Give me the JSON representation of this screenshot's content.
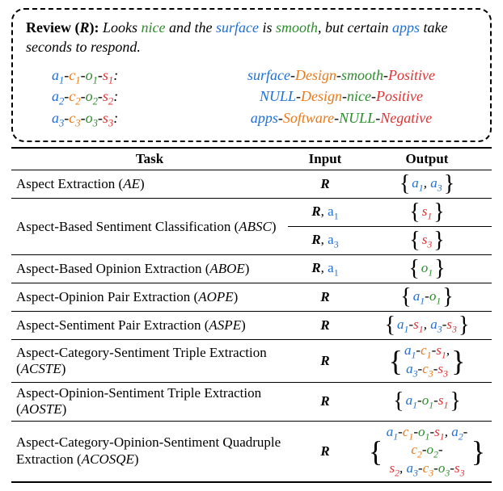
{
  "review": {
    "label": "Review (",
    "symbol": "R",
    "close": "): ",
    "text_parts": [
      {
        "t": "Looks ",
        "cls": ""
      },
      {
        "t": "nice",
        "cls": "o"
      },
      {
        "t": " and the ",
        "cls": ""
      },
      {
        "t": "surface",
        "cls": "a"
      },
      {
        "t": " is ",
        "cls": ""
      },
      {
        "t": "smooth",
        "cls": "o"
      },
      {
        "t": ", but certain ",
        "cls": ""
      },
      {
        "t": "apps",
        "cls": "a"
      },
      {
        "t": " take seconds to respond.",
        "cls": ""
      }
    ]
  },
  "triples": [
    {
      "lhs": [
        {
          "t": "a",
          "sub": "1",
          "cls": "a"
        },
        {
          "t": "-",
          "cls": "dash"
        },
        {
          "t": "c",
          "sub": "1",
          "cls": "c"
        },
        {
          "t": "-",
          "cls": "dash"
        },
        {
          "t": "o",
          "sub": "1",
          "cls": "o"
        },
        {
          "t": "-",
          "cls": "dash"
        },
        {
          "t": "s",
          "sub": "1",
          "cls": "s"
        },
        {
          "t": ":",
          "cls": "dash"
        }
      ],
      "rhs": [
        {
          "t": "surface",
          "cls": "a"
        },
        {
          "t": "-",
          "cls": "dash"
        },
        {
          "t": "Design",
          "cls": "c"
        },
        {
          "t": "-",
          "cls": "dash"
        },
        {
          "t": "smooth",
          "cls": "o"
        },
        {
          "t": "-",
          "cls": "dash"
        },
        {
          "t": "Positive",
          "cls": "s"
        }
      ]
    },
    {
      "lhs": [
        {
          "t": "a",
          "sub": "2",
          "cls": "a"
        },
        {
          "t": "-",
          "cls": "dash"
        },
        {
          "t": "c",
          "sub": "2",
          "cls": "c"
        },
        {
          "t": "-",
          "cls": "dash"
        },
        {
          "t": "o",
          "sub": "2",
          "cls": "o"
        },
        {
          "t": "-",
          "cls": "dash"
        },
        {
          "t": "s",
          "sub": "2",
          "cls": "s"
        },
        {
          "t": ":",
          "cls": "dash"
        }
      ],
      "rhs": [
        {
          "t": "NULL",
          "cls": "a"
        },
        {
          "t": "-",
          "cls": "dash"
        },
        {
          "t": "Design",
          "cls": "c"
        },
        {
          "t": "-",
          "cls": "dash"
        },
        {
          "t": "nice",
          "cls": "o"
        },
        {
          "t": "-",
          "cls": "dash"
        },
        {
          "t": "Positive",
          "cls": "s"
        }
      ]
    },
    {
      "lhs": [
        {
          "t": "a",
          "sub": "3",
          "cls": "a"
        },
        {
          "t": "-",
          "cls": "dash"
        },
        {
          "t": "c",
          "sub": "3",
          "cls": "c"
        },
        {
          "t": "-",
          "cls": "dash"
        },
        {
          "t": "o",
          "sub": "3",
          "cls": "o"
        },
        {
          "t": "-",
          "cls": "dash"
        },
        {
          "t": "s",
          "sub": "3",
          "cls": "s"
        },
        {
          "t": ":",
          "cls": "dash"
        }
      ],
      "rhs": [
        {
          "t": "apps",
          "cls": "a"
        },
        {
          "t": "-",
          "cls": "dash"
        },
        {
          "t": "Software",
          "cls": "c"
        },
        {
          "t": "-",
          "cls": "dash"
        },
        {
          "t": "NULL",
          "cls": "o"
        },
        {
          "t": "-",
          "cls": "dash"
        },
        {
          "t": "Negative",
          "cls": "s"
        }
      ]
    }
  ],
  "table": {
    "headers": {
      "task": "Task",
      "input": "Input",
      "output": "Output"
    },
    "rows": [
      {
        "name": "Aspect Extraction",
        "abbrev": "AE",
        "inputs": [
          [
            {
              "t": "R",
              "bold": true
            }
          ]
        ],
        "outputs": [
          [
            [
              {
                "t": "a",
                "sub": "1",
                "cls": "a"
              },
              {
                "t": ", ",
                "cls": "dash"
              },
              {
                "t": "a",
                "sub": "3",
                "cls": "a"
              }
            ]
          ]
        ]
      },
      {
        "name": "Aspect-Based Sentiment Classification",
        "abbrev": "ABSC",
        "multi": true,
        "inputs": [
          [
            {
              "t": "R",
              "bold": true
            },
            {
              "t": ", "
            },
            {
              "t": "a",
              "sub": "1",
              "cls": "a"
            }
          ],
          [
            {
              "t": "R",
              "bold": true
            },
            {
              "t": ", "
            },
            {
              "t": "a",
              "sub": "3",
              "cls": "a"
            }
          ]
        ],
        "outputs": [
          [
            [
              {
                "t": "s",
                "sub": "1",
                "cls": "s"
              }
            ]
          ],
          [
            [
              {
                "t": "s",
                "sub": "3",
                "cls": "s"
              }
            ]
          ]
        ]
      },
      {
        "name": "Aspect-Based Opinion Extraction",
        "abbrev": "ABOE",
        "inputs": [
          [
            {
              "t": "R",
              "bold": true
            },
            {
              "t": ", "
            },
            {
              "t": "a",
              "sub": "1",
              "cls": "a"
            }
          ]
        ],
        "outputs": [
          [
            [
              {
                "t": "o",
                "sub": "1",
                "cls": "o"
              }
            ]
          ]
        ]
      },
      {
        "name": "Aspect-Opinion Pair Extraction",
        "abbrev": "AOPE",
        "inputs": [
          [
            {
              "t": "R",
              "bold": true
            }
          ]
        ],
        "outputs": [
          [
            [
              {
                "t": "a",
                "sub": "1",
                "cls": "a"
              },
              {
                "t": "-",
                "cls": "dash"
              },
              {
                "t": "o",
                "sub": "1",
                "cls": "o"
              }
            ]
          ]
        ]
      },
      {
        "name": "Aspect-Sentiment Pair Extraction",
        "abbrev": "ASPE",
        "inputs": [
          [
            {
              "t": "R",
              "bold": true
            }
          ]
        ],
        "outputs": [
          [
            [
              {
                "t": "a",
                "sub": "1",
                "cls": "a"
              },
              {
                "t": "-",
                "cls": "dash"
              },
              {
                "t": "s",
                "sub": "1",
                "cls": "s"
              },
              {
                "t": ", ",
                "cls": "dash"
              },
              {
                "t": "a",
                "sub": "3",
                "cls": "a"
              },
              {
                "t": "-",
                "cls": "dash"
              },
              {
                "t": "s",
                "sub": "3",
                "cls": "s"
              }
            ]
          ]
        ]
      },
      {
        "name": "Aspect-Category-Sentiment Triple Extraction",
        "abbrev": "ACSTE",
        "multi": true,
        "inputs": [
          [
            {
              "t": "R",
              "bold": true
            }
          ]
        ],
        "outputs": [
          [
            [
              {
                "t": "a",
                "sub": "1",
                "cls": "a"
              },
              {
                "t": "-",
                "cls": "dash"
              },
              {
                "t": "c",
                "sub": "1",
                "cls": "c"
              },
              {
                "t": "-",
                "cls": "dash"
              },
              {
                "t": "s",
                "sub": "1",
                "cls": "s"
              },
              {
                "t": ",",
                "cls": "dash"
              }
            ],
            [
              {
                "t": "a",
                "sub": "3",
                "cls": "a"
              },
              {
                "t": "-",
                "cls": "dash"
              },
              {
                "t": "c",
                "sub": "3",
                "cls": "c"
              },
              {
                "t": "-",
                "cls": "dash"
              },
              {
                "t": "s",
                "sub": "3",
                "cls": "s"
              }
            ]
          ]
        ]
      },
      {
        "name": "Aspect-Opinion-Sentiment Triple Extraction",
        "abbrev": "AOSTE",
        "multi": true,
        "inputs": [
          [
            {
              "t": "R",
              "bold": true
            }
          ]
        ],
        "outputs": [
          [
            [
              {
                "t": "a",
                "sub": "1",
                "cls": "a"
              },
              {
                "t": "-",
                "cls": "dash"
              },
              {
                "t": "o",
                "sub": "1",
                "cls": "o"
              },
              {
                "t": "-",
                "cls": "dash"
              },
              {
                "t": "s",
                "sub": "1",
                "cls": "s"
              }
            ]
          ]
        ]
      },
      {
        "name": "Aspect-Category-Opinion-Sentiment Quadruple Extraction",
        "abbrev": "ACOSQE",
        "multi": true,
        "inputs": [
          [
            {
              "t": "R",
              "bold": true
            }
          ]
        ],
        "outputs": [
          [
            [
              {
                "t": "a",
                "sub": "1",
                "cls": "a"
              },
              {
                "t": "-",
                "cls": "dash"
              },
              {
                "t": "c",
                "sub": "1",
                "cls": "c"
              },
              {
                "t": "-",
                "cls": "dash"
              },
              {
                "t": "o",
                "sub": "1",
                "cls": "o"
              },
              {
                "t": "-",
                "cls": "dash"
              },
              {
                "t": "s",
                "sub": "1",
                "cls": "s"
              },
              {
                "t": ", ",
                "cls": "dash"
              },
              {
                "t": "a",
                "sub": "2",
                "cls": "a"
              },
              {
                "t": "-",
                "cls": "dash"
              },
              {
                "t": "c",
                "sub": "2",
                "cls": "c"
              },
              {
                "t": "-",
                "cls": "dash"
              },
              {
                "t": "o",
                "sub": "2",
                "cls": "o"
              },
              {
                "t": "-",
                "cls": "dash"
              }
            ],
            [
              {
                "t": "s",
                "sub": "2",
                "cls": "s"
              },
              {
                "t": ", ",
                "cls": "dash"
              },
              {
                "t": "a",
                "sub": "3",
                "cls": "a"
              },
              {
                "t": "-",
                "cls": "dash"
              },
              {
                "t": "c",
                "sub": "3",
                "cls": "c"
              },
              {
                "t": "-",
                "cls": "dash"
              },
              {
                "t": "o",
                "sub": "3",
                "cls": "o"
              },
              {
                "t": "-",
                "cls": "dash"
              },
              {
                "t": "s",
                "sub": "3",
                "cls": "s"
              }
            ]
          ]
        ]
      }
    ]
  }
}
